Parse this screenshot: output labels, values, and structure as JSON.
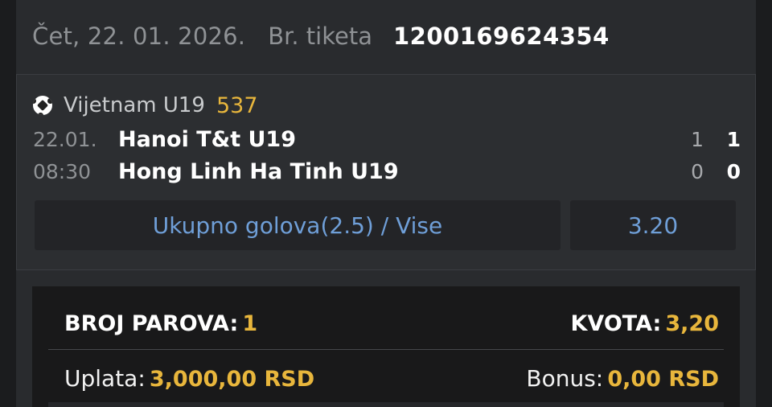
{
  "header": {
    "date": "Čet, 22. 01. 2026.",
    "ticket_label": "Br. tiketa",
    "ticket_number": "1200169624354"
  },
  "match": {
    "league_icon": "soccer-ball-icon",
    "league_name": "Vijetnam U19",
    "league_code": "537",
    "date": "22.01.",
    "time": "08:30",
    "home_team": "Hanoi T&t U19",
    "away_team": "Hong Linh Ha Tinh U19",
    "home_score_1": "1",
    "home_score_2": "1",
    "away_score_1": "0",
    "away_score_2": "0",
    "bet_label": "Ukupno golova(2.5) / Vise",
    "odd": "3.20"
  },
  "summary": {
    "pairs_label": "BROJ PAROVA:",
    "pairs_value": "1",
    "odds_label": "KVOTA:",
    "odds_value": "3,20",
    "stake_label": "Uplata:",
    "stake_value": "3,000,00 RSD",
    "bonus_label": "Bonus:",
    "bonus_value": "0,00 RSD"
  },
  "colors": {
    "accent_gold": "#e8b63c",
    "bet_blue": "#6f9fd8",
    "background": "#1b1c1e"
  }
}
